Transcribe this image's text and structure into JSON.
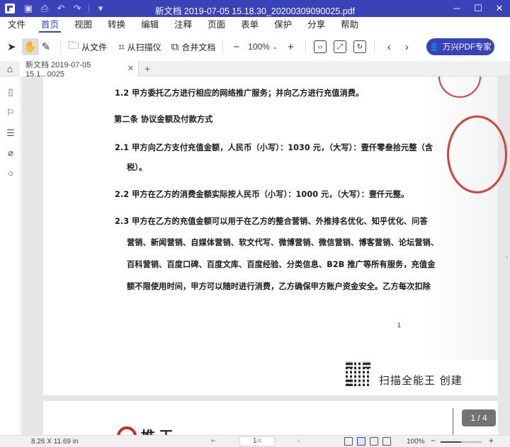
{
  "window": {
    "title": "新文档 2019-07-05 15.18.30_20200309090025.pdf",
    "quick_access": [
      "save-icon",
      "print-icon",
      "undo-icon",
      "redo-icon",
      "customize-icon"
    ]
  },
  "menu": [
    "文件",
    "首页",
    "视图",
    "转换",
    "编辑",
    "注释",
    "页面",
    "表单",
    "保护",
    "分享",
    "帮助"
  ],
  "menu_active": "首页",
  "toolbar": {
    "from_file": "从文件",
    "from_scanner": "从扫描仪",
    "merge": "合并文档",
    "zoom": "100%",
    "brand_button": "万兴PDF专家"
  },
  "tabs": [
    {
      "label": "新文档 2019-07-05 15.1...0025"
    }
  ],
  "document": {
    "lines": [
      "1.2  甲方委托乙方进行相应的网络推广服务；并向乙方进行充值消费。",
      "第二条  协议金额及付款方式",
      "2.1   甲方向乙方支付充值金额，人民币（小写）：1030 元，（大写）：壹仟零叁拾元整（含",
      "税）。",
      "2.2   甲方在乙方的消费金额实际按人民币（小写）：1000 元，（大写）：壹仟元整。",
      "2.3   甲方在乙方的充值金额可以用于在乙方的整合营销、外推排名优化、知乎优化、问答",
      "营销、新闻营销、自媒体营销、软文代写、微博营销、微信营销、博客营销、论坛营销、",
      "百科营销、百度口碑、百度文库、百度经验、分类信息、B2B 推广等所有服务，充值金",
      "额不限使用时间，甲方可以随时进行消费，乙方确保甲方账户资金安全。乙方每次扣除"
    ],
    "footer_page_mark": "1",
    "scan_watermark": "扫描全能王  创建",
    "page2_heading": "推  王"
  },
  "page_indicator": "1 / 4",
  "status": {
    "dimensions": "8.26 X 11.69 in",
    "current_page": "1",
    "total_pages": "/4",
    "zoom": "100%",
    "zoom_level": 0.5
  }
}
